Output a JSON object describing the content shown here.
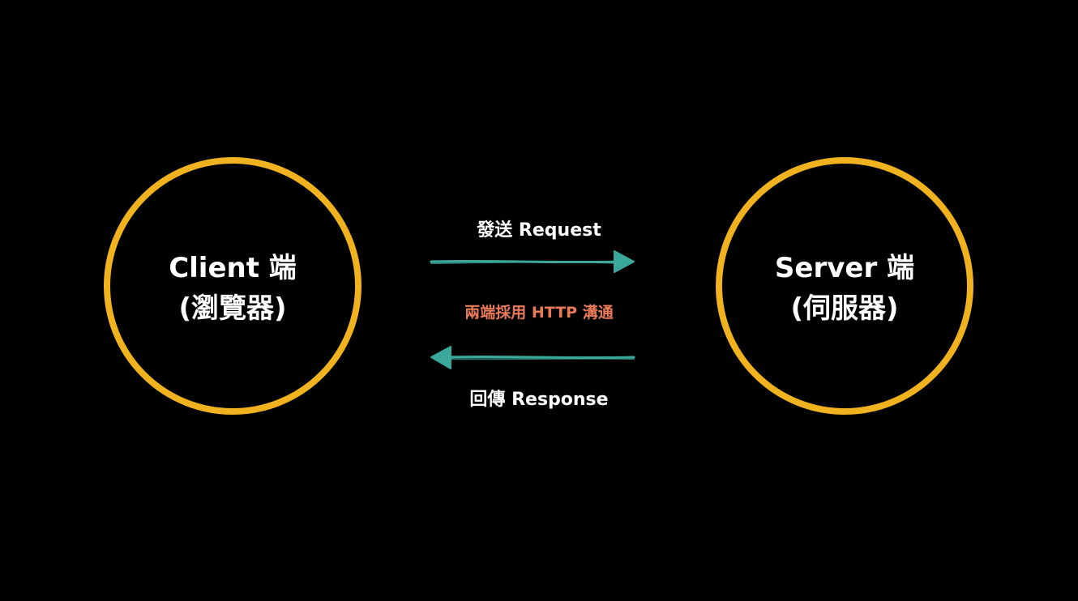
{
  "diagram": {
    "client": {
      "title": "Client 端",
      "subtitle": "(瀏覽器)"
    },
    "server": {
      "title": "Server 端",
      "subtitle": "(伺服器)"
    },
    "request_label": "發送 Request",
    "protocol_label": "兩端採用 HTTP 溝通",
    "response_label": "回傳 Response"
  },
  "colors": {
    "background": "#000000",
    "circle": "#f0b21e",
    "text": "#ffffff",
    "arrow": "#3aa99b",
    "protocol": "#e97a5a"
  }
}
